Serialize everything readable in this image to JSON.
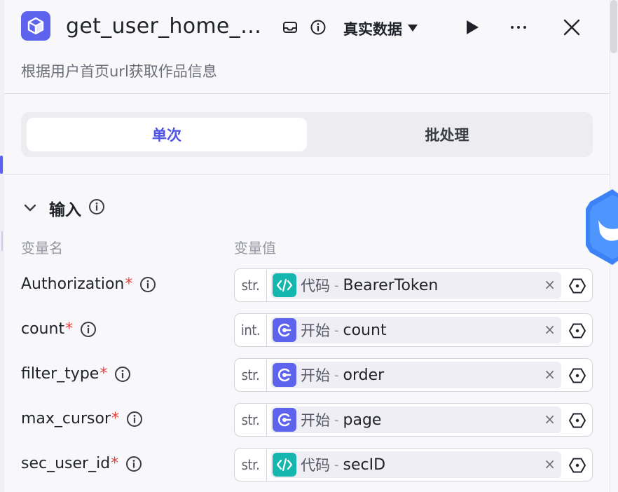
{
  "header": {
    "title": "get_user_home_…",
    "description": "根据用户首页url获取作品信息",
    "data_mode_label": "真实数据",
    "icons": [
      "cube-icon",
      "inbox-icon",
      "info-icon",
      "caret-down-icon",
      "play-icon",
      "more-icon",
      "close-icon"
    ]
  },
  "mode_tabs": [
    {
      "label": "单次",
      "active": true
    },
    {
      "label": "批处理",
      "active": false
    }
  ],
  "input_section": {
    "title": "输入",
    "col_name": "变量名",
    "col_value": "变量值",
    "rows": [
      {
        "name": "Authorization",
        "required": "*",
        "type": "str.",
        "node_icon": "code-icon",
        "node": "代码",
        "sep": "-",
        "value": "BearerToken"
      },
      {
        "name": "count",
        "required": "*",
        "type": "int.",
        "node_icon": "start-icon",
        "node": "开始",
        "sep": "-",
        "value": "count"
      },
      {
        "name": "filter_type",
        "required": "*",
        "type": "str.",
        "node_icon": "start-icon",
        "node": "开始",
        "sep": "-",
        "value": "order"
      },
      {
        "name": "max_cursor",
        "required": "*",
        "type": "str.",
        "node_icon": "start-icon",
        "node": "开始",
        "sep": "-",
        "value": "page"
      },
      {
        "name": "sec_user_id",
        "required": "*",
        "type": "str.",
        "node_icon": "code-icon",
        "node": "代码",
        "sep": "-",
        "value": "secID"
      }
    ],
    "clear_symbol": "×"
  },
  "colors": {
    "accent": "#5e63ee",
    "code_node": "#15b6ae",
    "required": "#e5403b",
    "badge": "#3b82f6"
  }
}
